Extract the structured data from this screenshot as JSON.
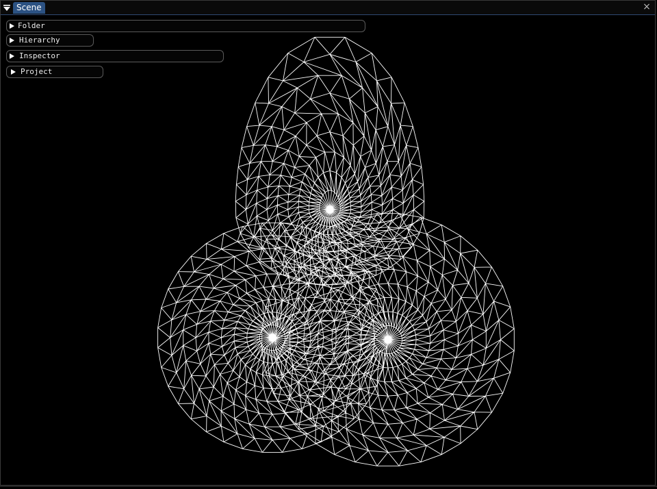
{
  "window": {
    "tab_label": "Scene",
    "close_glyph": "×"
  },
  "panels": [
    {
      "label": "Folder"
    },
    {
      "label": "Hierarchy"
    },
    {
      "label": "Inspector"
    },
    {
      "label": "Project"
    }
  ],
  "mesh": {
    "line_color": "#ffffff",
    "background": "#000000"
  }
}
